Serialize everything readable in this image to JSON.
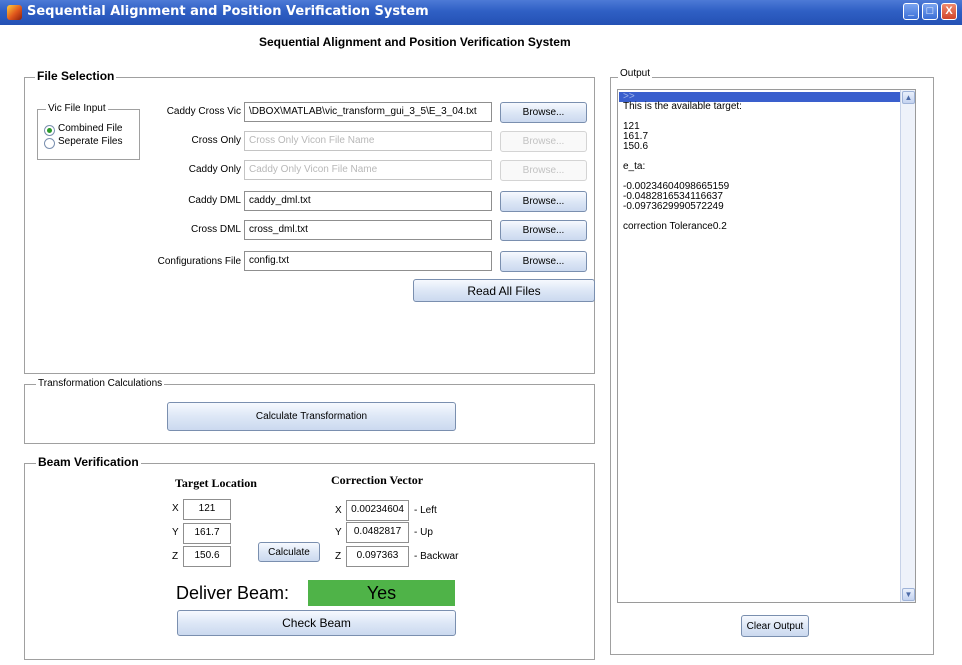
{
  "window": {
    "title": "Sequential Alignment and Position Verification System",
    "controls": [
      "_",
      "□",
      "X"
    ]
  },
  "header": {
    "title": "Sequential Alignment and Position Verification System"
  },
  "file_selection": {
    "title": "File Selection",
    "vic_input": {
      "title": "Vic File Input",
      "options": [
        {
          "label": "Combined File",
          "selected": true
        },
        {
          "label": "Seperate Files",
          "selected": false
        }
      ]
    },
    "rows": [
      {
        "label": "Caddy Cross Vic",
        "value": "\\DBOX\\MATLAB\\vic_transform_gui_3_5\\E_3_04.txt",
        "placeholder": "",
        "enabled": true,
        "button": "Browse..."
      },
      {
        "label": "Cross Only",
        "value": "",
        "placeholder": "Cross Only Vicon File Name",
        "enabled": false,
        "button": "Browse..."
      },
      {
        "label": "Caddy Only",
        "value": "",
        "placeholder": "Caddy Only Vicon File Name",
        "enabled": false,
        "button": "Browse..."
      },
      {
        "label": "Caddy DML",
        "value": "caddy_dml.txt",
        "placeholder": "",
        "enabled": true,
        "button": "Browse..."
      },
      {
        "label": "Cross DML",
        "value": "cross_dml.txt",
        "placeholder": "",
        "enabled": true,
        "button": "Browse..."
      },
      {
        "label": "Configurations File",
        "value": "config.txt",
        "placeholder": "",
        "enabled": true,
        "button": "Browse..."
      }
    ],
    "read_all_label": "Read All Files"
  },
  "transformation": {
    "title": "Transformation Calculations",
    "calculate_label": "Calculate Transformation"
  },
  "beam": {
    "title": "Beam Verification",
    "target": {
      "title": "Target Location",
      "x_label": "X",
      "x": "121",
      "y_label": "Y",
      "y": "161.7",
      "z_label": "Z",
      "z": "150.6"
    },
    "calculate_label": "Calculate",
    "correction": {
      "title": "Correction Vector",
      "x_label": "X",
      "x": "0.00234604",
      "x_dir": "- Left",
      "y_label": "Y",
      "y": "0.0482817",
      "y_dir": "- Up",
      "z_label": "Z",
      "z": "0.097363",
      "z_dir": "- Backwar"
    },
    "deliver_label": "Deliver Beam:",
    "deliver_value": "Yes",
    "deliver_color": "#4fb348",
    "check_label": "Check Beam"
  },
  "output": {
    "title": "Output",
    "lines": [
      ">>",
      "This is the available target:",
      "",
      "121",
      "161.7",
      "150.6",
      "",
      "e_ta:",
      "",
      "-0.00234604098665159",
      "-0.0482816534116637",
      "-0.0973629990572249",
      "",
      "correction Tolerance0.2"
    ],
    "clear_label": "Clear Output"
  }
}
